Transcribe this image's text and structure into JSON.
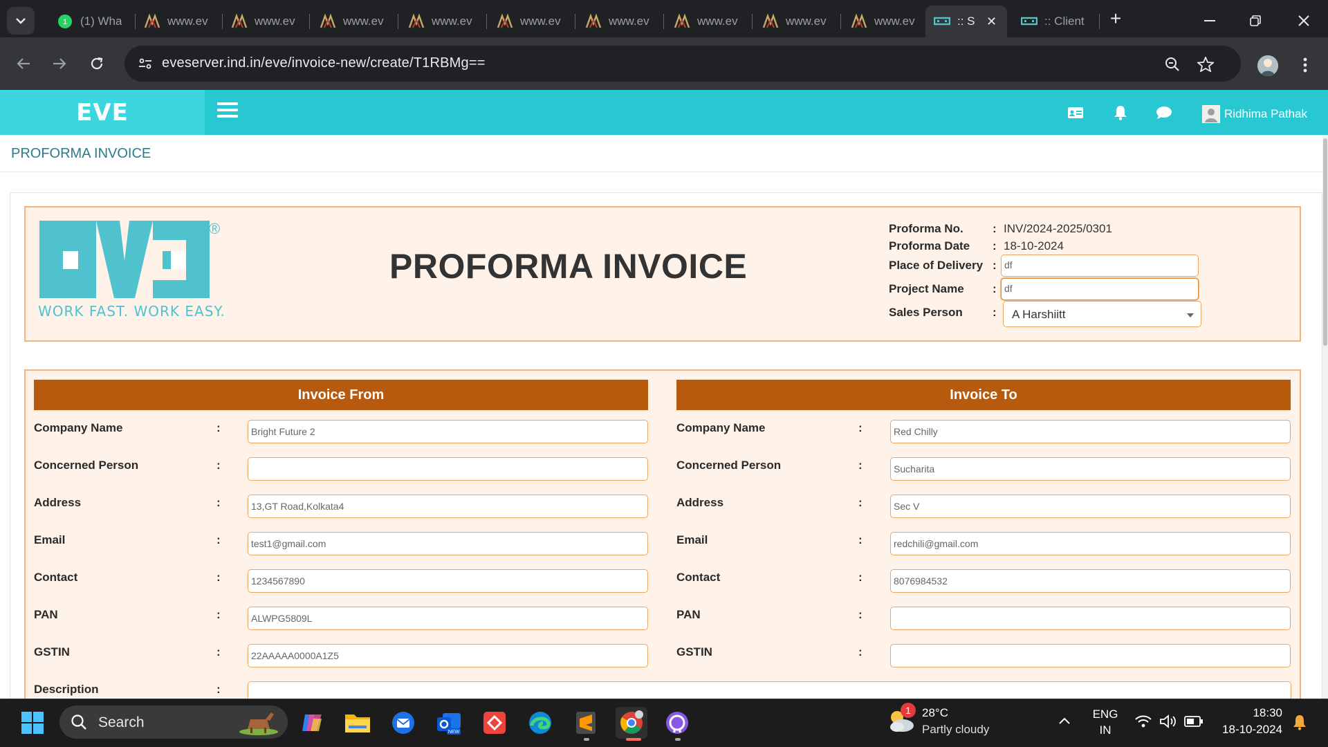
{
  "browser": {
    "tabs": [
      {
        "title": "(1) Wha",
        "icon": "whatsapp-icon"
      },
      {
        "title": "www.ev",
        "icon": "site-logo-icon"
      },
      {
        "title": "www.ev",
        "icon": "site-logo-icon"
      },
      {
        "title": "www.ev",
        "icon": "site-logo-icon"
      },
      {
        "title": "www.ev",
        "icon": "site-logo-icon"
      },
      {
        "title": "www.ev",
        "icon": "site-logo-icon"
      },
      {
        "title": "www.ev",
        "icon": "site-logo-icon"
      },
      {
        "title": "www.ev",
        "icon": "site-logo-icon"
      },
      {
        "title": "www.ev",
        "icon": "site-logo-icon"
      },
      {
        "title": "www.ev",
        "icon": "site-logo-icon"
      },
      {
        "title": ":: S",
        "icon": "eve-icon",
        "active": true
      },
      {
        "title": ":: Client",
        "icon": "eve-icon"
      }
    ],
    "url": "eveserver.ind.in/eve/invoice-new/create/T1RBMg=="
  },
  "app": {
    "brand": "EVE",
    "user_name": "Ridhima Pathak",
    "page_title": "PROFORMA INVOICE",
    "accent_color": "#27c8d1"
  },
  "invoice": {
    "heading": "PROFORMA INVOICE",
    "logo_tagline": "WORK FAST. WORK EASY.",
    "meta": {
      "no_label": "Proforma No.",
      "no_value": "INV/2024-2025/0301",
      "date_label": "Proforma Date",
      "date_value": "18-10-2024",
      "delivery_label": "Place of Delivery",
      "delivery_value": "df",
      "project_label": "Project Name",
      "project_value": "df",
      "sales_label": "Sales Person",
      "sales_value": "A Harshiitt"
    },
    "from": {
      "title": "Invoice From",
      "company": "Bright Future 2",
      "person": "",
      "address": "13,GT Road,Kolkata4",
      "email": "test1@gmail.com",
      "contact": "1234567890",
      "pan": "ALWPG5809L",
      "gstin": "22AAAAA0000A1Z5"
    },
    "to": {
      "title": "Invoice To",
      "company": "Red Chilly",
      "person": "Sucharita",
      "address": "Sec V",
      "email": "redchili@gmail.com",
      "contact": "8076984532",
      "pan": "",
      "gstin": ""
    },
    "labels": {
      "company": "Company Name",
      "person": "Concerned Person",
      "address": "Address",
      "email": "Email",
      "contact": "Contact",
      "pan": "PAN",
      "gstin": "GSTIN",
      "description": "Description",
      "colon": ":"
    },
    "description": ""
  },
  "taskbar": {
    "search_label": "Search",
    "weather_temp": "28°C",
    "weather_desc": "Partly cloudy",
    "weather_badge": "1",
    "lang_top": "ENG",
    "lang_bottom": "IN",
    "time": "18:30",
    "date": "18-10-2024"
  }
}
